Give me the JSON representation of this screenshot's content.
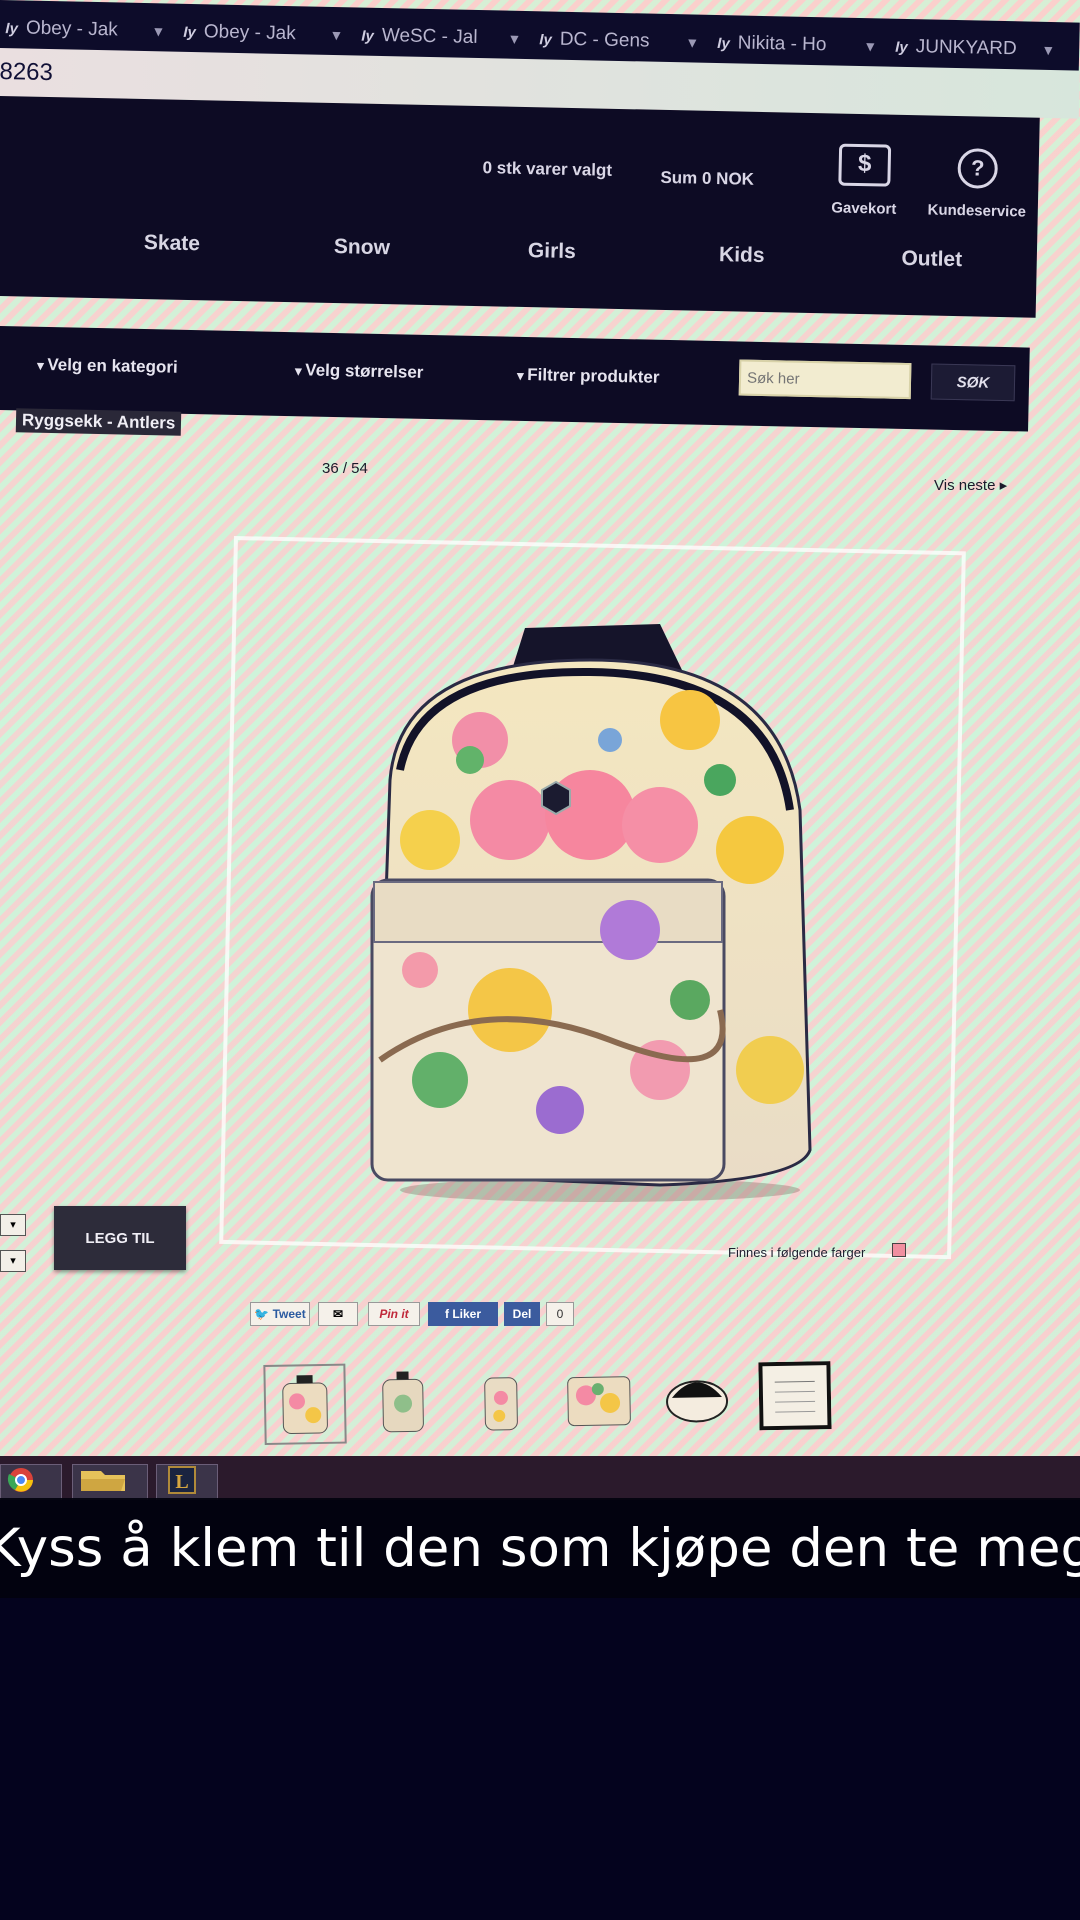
{
  "browser": {
    "tabs": [
      {
        "label": "Obey - Jak"
      },
      {
        "label": "Obey - Jak"
      },
      {
        "label": "WeSC - Jal"
      },
      {
        "label": "DC - Gens"
      },
      {
        "label": "Nikita - Ho"
      },
      {
        "label": "JUNKYARD"
      }
    ],
    "url_fragment": "8263"
  },
  "header": {
    "cart_items": "0 stk varer valgt",
    "cart_sum": "Sum 0 NOK",
    "giftcard_label": "Gavekort",
    "customer_service_label": "Kundeservice"
  },
  "nav": [
    "Skate",
    "Snow",
    "Girls",
    "Kids",
    "Outlet"
  ],
  "filters": {
    "category": "Velg en kategori",
    "sizes": "Velg størrelser",
    "filter_products": "Filtrer produkter",
    "search_placeholder": "Søk her",
    "search_button": "SØK"
  },
  "product": {
    "breadcrumb": "Ryggsekk - Antlers",
    "counter": "36 / 54",
    "next_label": "Vis neste",
    "add_button": "LEGG TIL",
    "colors_note": "Finnes i følgende farger",
    "swatch_color": "#f08fa0"
  },
  "share": {
    "tweet": "Tweet",
    "pinit": "Pin it",
    "like": "Liker",
    "share": "Del",
    "like_count": "0"
  },
  "caption": "Kyss å klem til den som kjøpe den te meg"
}
